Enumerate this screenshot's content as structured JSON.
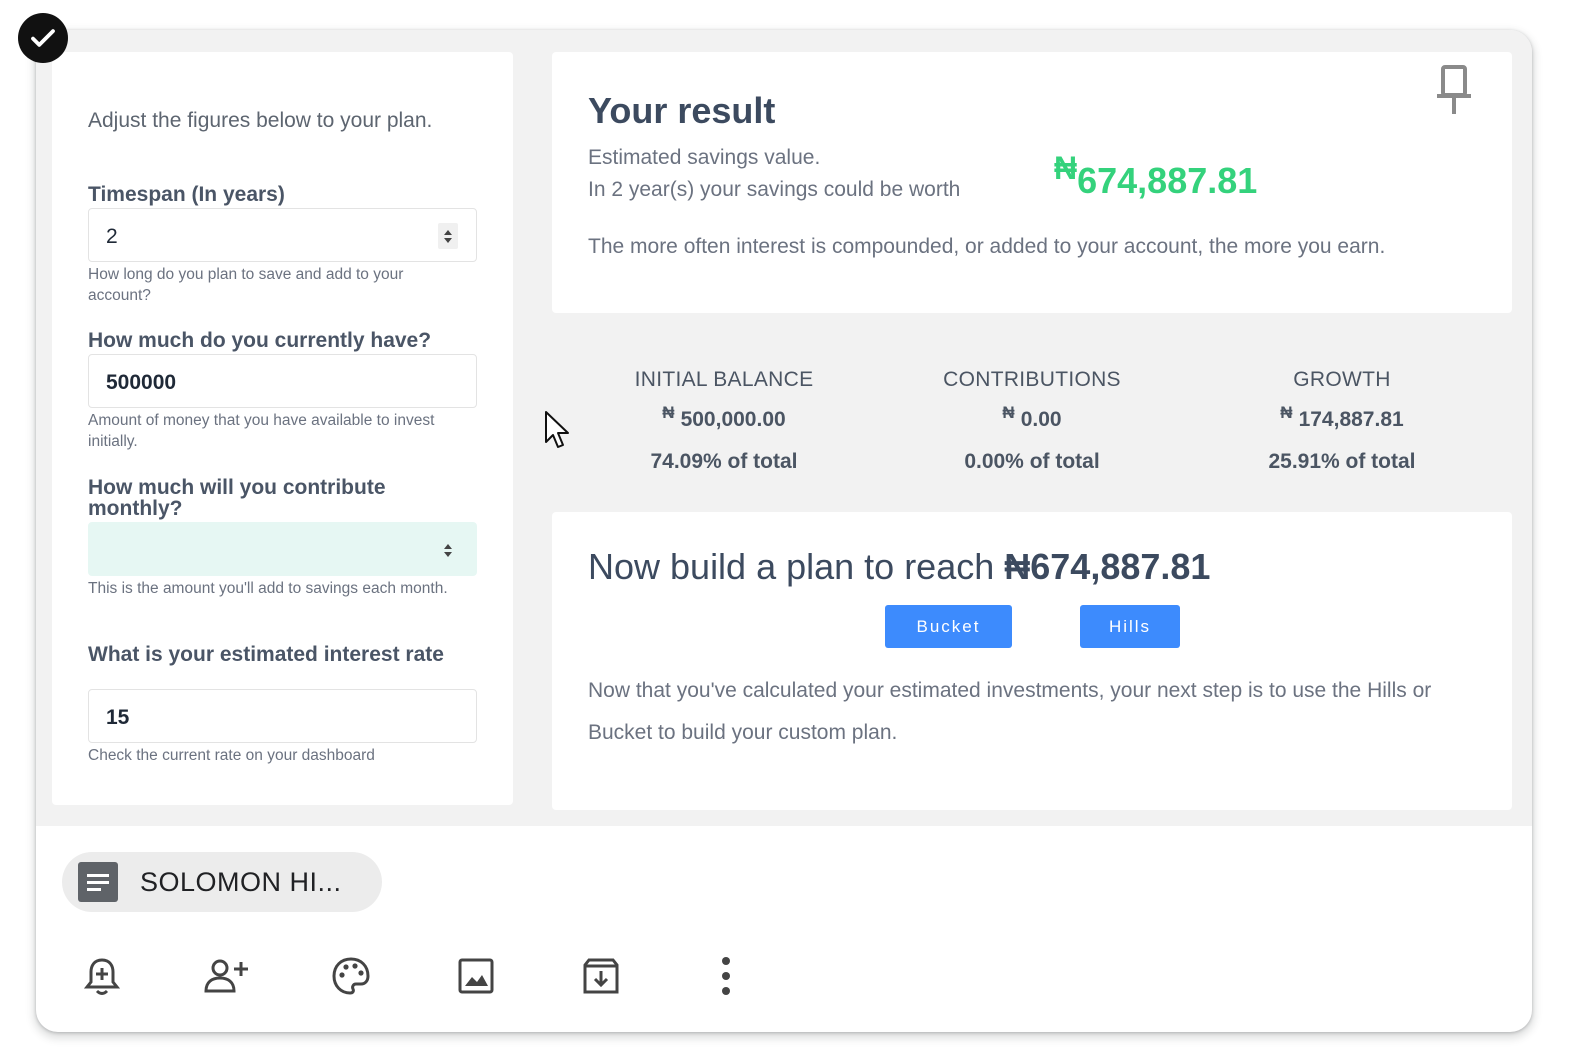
{
  "intro_text": "Adjust the figures below to your plan.",
  "fields": [
    {
      "label": "Timespan (In years)",
      "value": "2",
      "help": "How long do you plan to save and add to your account?"
    },
    {
      "label": "How much do you currently have?",
      "value": "500000",
      "help": "Amount of money that you have available to invest initially."
    },
    {
      "label": "How much will you contribute monthly?",
      "value": "",
      "help": "This is the amount you'll add to savings each month."
    },
    {
      "label": "What is your estimated interest rate",
      "value": "15",
      "help": "Check the current rate on your dashboard"
    }
  ],
  "result": {
    "title": "Your result",
    "line1": "Estimated savings value.",
    "line2": "In 2 year(s) your savings could be worth",
    "currency": "₦",
    "value": "674,887.81",
    "note": "The more often interest is compounded, or added to your account, the more you earn."
  },
  "stats": [
    {
      "heading": "INITIAL BALANCE",
      "currency": "₦",
      "value": "500,000.00",
      "percent": "74.09% of total"
    },
    {
      "heading": "CONTRIBUTIONS",
      "currency": "₦",
      "value": "0.00",
      "percent": "0.00% of total"
    },
    {
      "heading": "GROWTH",
      "currency": "₦",
      "value": "174,887.81",
      "percent": "25.91% of total"
    }
  ],
  "plan": {
    "title_prefix": "Now build a plan to reach ",
    "title_amount": "₦674,887.81",
    "buttons": [
      "Bucket",
      "Hills"
    ],
    "text": "Now that you've calculated your estimated investments, your next step is to use the Hills or Bucket to build your custom plan."
  },
  "chip_label": "SOLOMON HI...",
  "toolbar_icons": [
    "add-reminder-icon",
    "collaborator-icon",
    "palette-icon",
    "image-icon",
    "archive-icon",
    "more-vert-icon"
  ],
  "colors": {
    "accent_green": "#34d27c",
    "button_blue": "#3d8bfd",
    "input_teal": "#e6f7f3"
  }
}
